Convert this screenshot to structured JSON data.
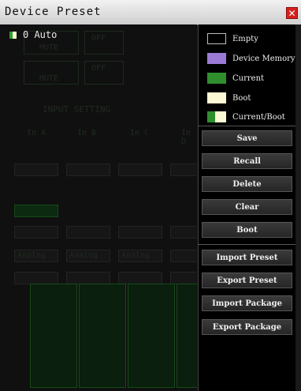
{
  "window": {
    "title": "Device Preset",
    "close_label": "✕"
  },
  "preset_list": {
    "items": [
      {
        "label": "0 Auto"
      }
    ]
  },
  "legend": [
    {
      "label": "Empty",
      "color_left": "#000000",
      "color_right": "#000000",
      "border": "#bbbbbb"
    },
    {
      "label": "Device Memory",
      "color_left": "#9b7ad6",
      "color_right": "#9b7ad6",
      "border": "#9b7ad6"
    },
    {
      "label": "Current",
      "color_left": "#2f8f2f",
      "color_right": "#2f8f2f",
      "border": "#2f8f2f"
    },
    {
      "label": "Boot",
      "color_left": "#fbf8d4",
      "color_right": "#fbf8d4",
      "border": "#fbf8d4"
    },
    {
      "label": "Current/Boot",
      "color_left": "#2f8f2f",
      "color_right": "#fbf8d4",
      "border": "#fbf8d4"
    }
  ],
  "buttons": {
    "save": "Save",
    "recall": "Recall",
    "delete": "Delete",
    "clear": "Clear",
    "boot": "Boot",
    "import_preset": "Import Preset",
    "export_preset": "Export Preset",
    "import_package": "Import Package",
    "export_package": "Export Package"
  },
  "background_ghost": {
    "section_title": "INPUT SETTING",
    "channels": [
      "In A",
      "In B",
      "In C",
      "In D"
    ],
    "input_type": "Analog",
    "labels": [
      "OFF",
      "MUTE"
    ]
  }
}
